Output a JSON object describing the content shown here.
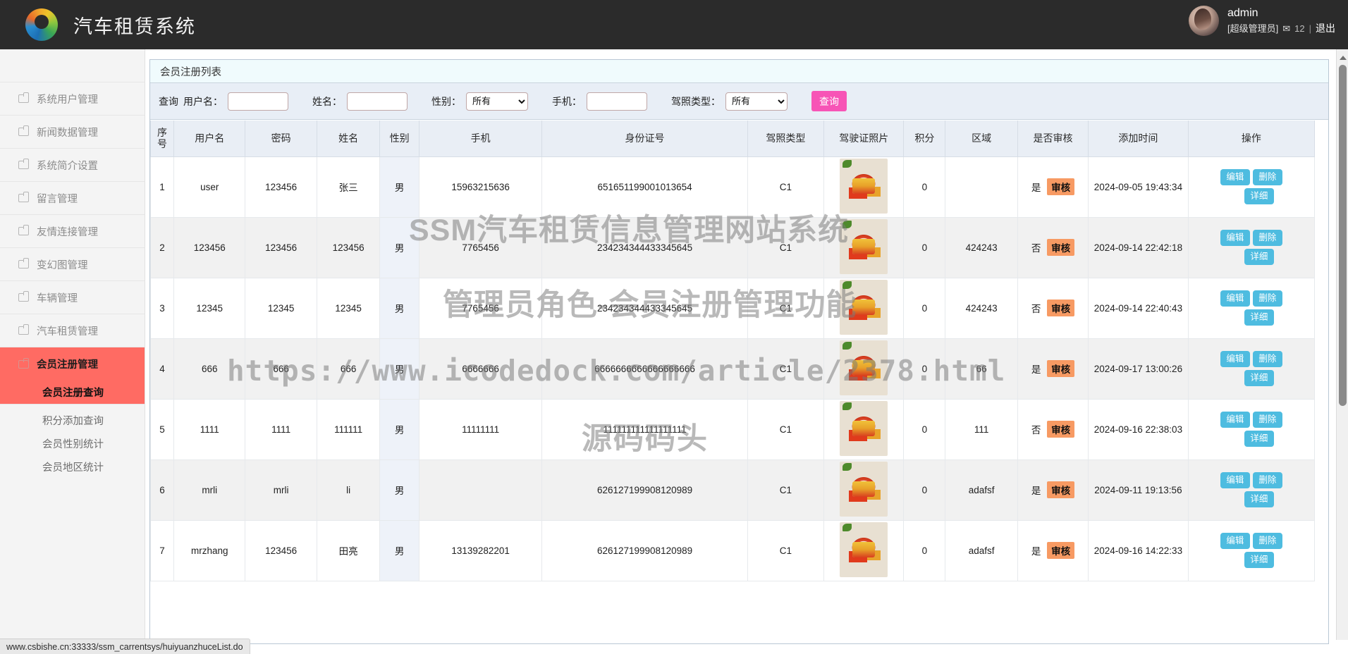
{
  "header": {
    "brand_title": "汽车租赁系统",
    "logo_icon": "color-ring-logo-icon",
    "user_name": "admin",
    "user_role": "[超级管理员]",
    "mail_icon": "✉",
    "mail_count": "12",
    "separator": "|",
    "logout_label": "退出"
  },
  "sidebar": {
    "items": [
      {
        "label": "系统用户管理",
        "icon": "folder-icon"
      },
      {
        "label": "新闻数据管理",
        "icon": "folder-icon"
      },
      {
        "label": "系统简介设置",
        "icon": "folder-icon"
      },
      {
        "label": "留言管理",
        "icon": "folder-icon"
      },
      {
        "label": "友情连接管理",
        "icon": "folder-icon"
      },
      {
        "label": "变幻图管理",
        "icon": "folder-icon"
      },
      {
        "label": "车辆管理",
        "icon": "folder-icon"
      },
      {
        "label": "汽车租赁管理",
        "icon": "folder-icon"
      }
    ],
    "active_group": {
      "label": "会员注册管理",
      "icon": "folder-icon"
    },
    "active_sub": "会员注册查询",
    "sub_items": [
      "积分添加查询",
      "会员性别统计",
      "会员地区统计"
    ]
  },
  "panel": {
    "title": "会员注册列表"
  },
  "filter": {
    "lead_label": "查询",
    "username_label": "用户名：",
    "username_value": "",
    "name_label": "姓名：",
    "name_value": "",
    "gender_label": "性别：",
    "gender_value": "所有",
    "gender_options": [
      "所有"
    ],
    "phone_label": "手机：",
    "phone_value": "",
    "license_label": "驾照类型：",
    "license_value": "所有",
    "license_options": [
      "所有"
    ],
    "search_button": "查询"
  },
  "table": {
    "columns": [
      "序号",
      "用户名",
      "密码",
      "姓名",
      "性别",
      "手机",
      "身份证号",
      "驾照类型",
      "驾驶证照片",
      "积分",
      "区域",
      "是否审核",
      "添加时间",
      "操作"
    ],
    "audit_badge": "审核",
    "ops": {
      "edit": "编辑",
      "delete": "删除",
      "detail": "详细"
    },
    "rows": [
      {
        "index": "1",
        "username": "user",
        "password": "123456",
        "name": "张三",
        "gender": "男",
        "phone": "15963215636",
        "idcard": "651651199001013654",
        "license": "C1",
        "photo": "license-photo",
        "points": "0",
        "region": "",
        "audited": "是",
        "created": "2024-09-05 19:43:34"
      },
      {
        "index": "2",
        "username": "123456",
        "password": "123456",
        "name": "123456",
        "gender": "男",
        "phone": "7765456",
        "idcard": "234234344433345645",
        "license": "C1",
        "photo": "license-photo",
        "points": "0",
        "region": "424243",
        "audited": "否",
        "created": "2024-09-14 22:42:18"
      },
      {
        "index": "3",
        "username": "12345",
        "password": "12345",
        "name": "12345",
        "gender": "男",
        "phone": "7765456",
        "idcard": "234234344433345645",
        "license": "C1",
        "photo": "license-photo",
        "points": "0",
        "region": "424243",
        "audited": "否",
        "created": "2024-09-14 22:40:43"
      },
      {
        "index": "4",
        "username": "666",
        "password": "666",
        "name": "666",
        "gender": "男",
        "phone": "6666666",
        "idcard": "6666666666666666666",
        "license": "C1",
        "photo": "license-photo",
        "points": "0",
        "region": "66",
        "audited": "是",
        "created": "2024-09-17 13:00:26"
      },
      {
        "index": "5",
        "username": "1111",
        "password": "1111",
        "name": "111111",
        "gender": "男",
        "phone": "11111111",
        "idcard": "111111111111111111",
        "license": "C1",
        "photo": "license-photo",
        "points": "0",
        "region": "111",
        "audited": "否",
        "created": "2024-09-16 22:38:03"
      },
      {
        "index": "6",
        "username": "mrli",
        "password": "mrli",
        "name": "li",
        "gender": "男",
        "phone": "",
        "idcard": "626127199908120989",
        "license": "C1",
        "photo": "license-photo",
        "points": "0",
        "region": "adafsf",
        "audited": "是",
        "created": "2024-09-11 19:13:56"
      },
      {
        "index": "7",
        "username": "mrzhang",
        "password": "123456",
        "name": "田亮",
        "gender": "男",
        "phone": "13139282201",
        "idcard": "626127199908120989",
        "license": "C1",
        "photo": "license-photo",
        "points": "0",
        "region": "adafsf",
        "audited": "是",
        "created": "2024-09-16 14:22:33"
      }
    ]
  },
  "watermark": {
    "line1": "SSM汽车租赁信息管理网站系统",
    "line2": "管理员角色-会员注册管理功能",
    "line3": "https://www.icodedock.com/article/2378.html",
    "line4": "源码码头"
  },
  "statusbar": {
    "url": "www.csbishe.cn:33333/ssm_carrentsys/huiyuanzhuceList.do"
  },
  "colors": {
    "topbar": "#2b2b2b",
    "sidebar_active": "#ff6b63",
    "search_button": "#f754b6",
    "op_button": "#4ebce0",
    "audit_badge": "#f79a63"
  }
}
